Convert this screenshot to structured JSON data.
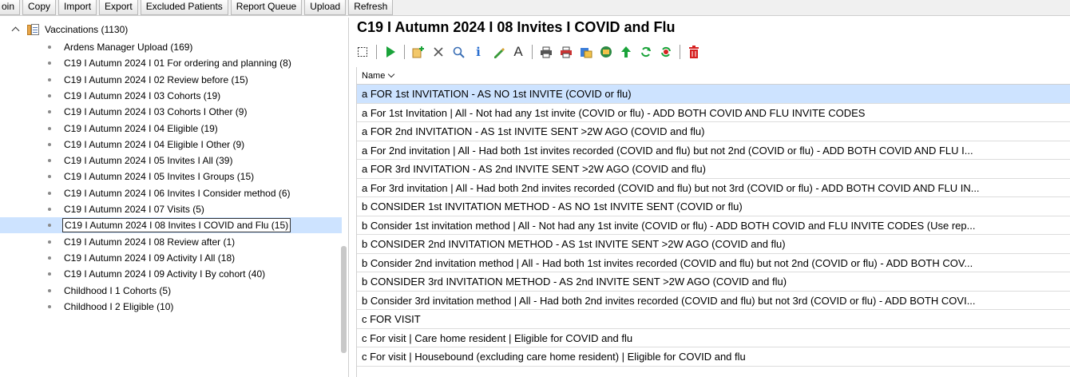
{
  "toolbar": {
    "buttons": [
      "oin",
      "Copy",
      "Import",
      "Export",
      "Excluded Patients",
      "Report Queue",
      "Upload",
      "Refresh"
    ]
  },
  "tree": {
    "root_label": "Vaccinations (1130)",
    "items": [
      "Ardens Manager Upload (169)",
      "C19 I Autumn 2024 I 01 For ordering and planning (8)",
      "C19 I Autumn 2024 I 02 Review before (15)",
      "C19 I Autumn 2024 I 03 Cohorts (19)",
      "C19 I Autumn 2024 I 03 Cohorts I Other (9)",
      "C19 I Autumn 2024 I 04 Eligible (19)",
      "C19 I Autumn 2024 I 04 Eligible I Other (9)",
      "C19 I Autumn 2024 I 05 Invites I All (39)",
      "C19 I Autumn 2024 I 05 Invites I Groups (15)",
      "C19 I Autumn 2024 I 06 Invites I Consider method (6)",
      "C19 I Autumn 2024 I 07 Visits (5)",
      "C19 I Autumn 2024 I 08 Invites I COVID and Flu (15)",
      "C19 I Autumn 2024 I 08 Review after (1)",
      "C19 I Autumn 2024 I 09 Activity I All (18)",
      "C19 I Autumn 2024 I 09 Activity I By cohort (40)",
      "Childhood I 1 Cohorts (5)",
      "Childhood I 2 Eligible (10)"
    ],
    "selected_index": 11
  },
  "panel": {
    "title": "C19 I Autumn 2024 I 08 Invites I COVID and Flu",
    "icons": [
      "select-icon",
      "run-icon",
      "add-icon",
      "delete-x-icon",
      "search-icon",
      "info-icon",
      "edit-icon",
      "font-icon",
      "print-icon",
      "print-color-icon",
      "export-icon",
      "record-icon",
      "upload-arrow-icon",
      "refresh-icon",
      "refresh-red-icon",
      "trash-icon"
    ],
    "column_header": "Name",
    "rows": [
      "a FOR 1st INVITATION - AS NO 1st INVITE (COVID or flu)",
      "a For 1st Invitation | All - Not had any 1st invite (COVID or flu) - ADD BOTH COVID AND FLU INVITE CODES",
      "a FOR 2nd INVITATION - AS 1st INVITE SENT >2W AGO (COVID and flu)",
      "a For 2nd invitation | All - Had both 1st invites recorded (COVID and flu) but not 2nd (COVID or flu) - ADD BOTH COVID AND FLU I...",
      "a FOR 3rd INVITATION - AS 2nd INVITE SENT >2W AGO (COVID and flu)",
      "a For 3rd invitation | All - Had both 2nd invites recorded (COVID and flu) but not 3rd (COVID or flu) - ADD BOTH COVID AND FLU IN...",
      "b CONSIDER 1st INVITATION METHOD - AS NO 1st INVITE SENT (COVID or flu)",
      "b Consider 1st invitation method | All - Not had any 1st invite (COVID or flu) - ADD BOTH COVID and FLU INVITE CODES (Use rep...",
      "b CONSIDER 2nd INVITATION METHOD - AS 1st INVITE SENT >2W AGO (COVID and flu)",
      "b Consider 2nd invitation method | All - Had both 1st invites recorded (COVID and flu) but not 2nd (COVID or flu) - ADD BOTH COV...",
      "b CONSIDER 3rd INVITATION METHOD - AS 2nd INVITE SENT >2W AGO (COVID and flu)",
      "b Consider 3rd invitation method | All - Had both 2nd invites recorded (COVID and flu) but not 3rd (COVID or flu) - ADD BOTH COVI...",
      "c FOR VISIT",
      "c For visit | Care home resident | Eligible for COVID and flu",
      "c For visit | Housebound (excluding care home resident) | Eligible for COVID and flu"
    ],
    "selected_row": 0
  },
  "colors": {
    "selection": "#cde3ff",
    "run_green": "#1aa33a",
    "delete_red": "#d62020"
  }
}
